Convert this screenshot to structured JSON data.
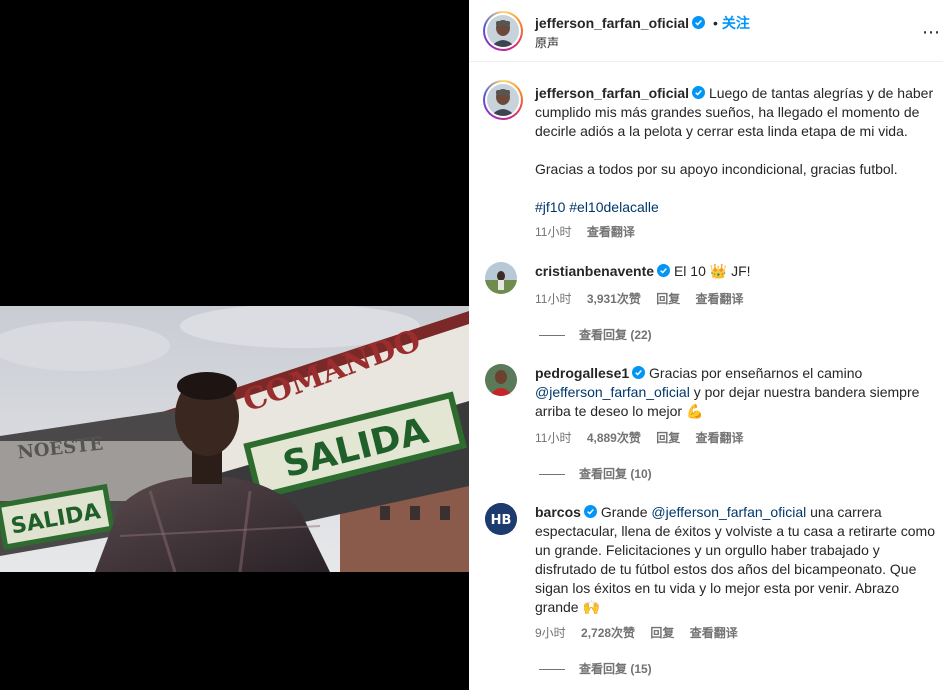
{
  "post": {
    "username": "jefferson_farfan_oficial",
    "follow_label": "关注",
    "audio_label": "原声",
    "more_icon": "more-horizontal-icon"
  },
  "media": {
    "sign_left": "SALIDA",
    "sign_right": "SALIDA",
    "banner": "COMANDO",
    "banner_left": "NOESTE"
  },
  "caption": {
    "username": "jefferson_farfan_oficial",
    "text_1": "Luego de tantas alegrías y de haber cumplido mis más grandes sueños, ha llegado el momento de decirle adiós a la pelota y cerrar esta linda etapa de mi vida.",
    "text_2": "Gracias a todos por su apoyo incondicional, gracias futbol.",
    "tag_1": "#jf10",
    "tag_2": "#el10delacalle",
    "time": "11小时",
    "translate": "查看翻译"
  },
  "comments": [
    {
      "username": "cristianbenavente",
      "text": "El 10",
      "emoji": "👑",
      "text_after": "JF!",
      "time": "11小时",
      "likes": "3,931次赞",
      "reply": "回复",
      "translate": "查看翻译",
      "view_replies": "查看回复 (22)"
    },
    {
      "username": "pedrogallese1",
      "text_1": "Gracias por enseñarnos el camino",
      "mention": "@jefferson_farfan_oficial",
      "text_2": "y por dejar nuestra bandera siempre arriba te deseo lo mejor",
      "emoji": "💪",
      "time": "11小时",
      "likes": "4,889次赞",
      "reply": "回复",
      "translate": "查看翻译",
      "view_replies": "查看回复 (10)"
    },
    {
      "username": "barcos",
      "text_1": "Grande",
      "mention": "@jefferson_farfan_oficial",
      "text_2": "una carrera espectacular, llena de éxitos y volviste a tu casa a retirarte como un grande. Felicitaciones y un orgullo haber trabajado y disfrutado de tu fútbol estos dos años del bicampeonato. Que sigan los éxitos en tu vida y lo mejor esta por venir. Abrazo grande",
      "emoji": "🙌",
      "time": "9小时",
      "likes": "2,728次赞",
      "reply": "回复",
      "translate": "查看翻译",
      "view_replies": "查看回复 (15)",
      "avatar_text": "HB"
    }
  ],
  "colors": {
    "follow_blue": "#0095f6",
    "link": "#00376b",
    "secondary": "#737373",
    "verified": "#0095f6"
  }
}
